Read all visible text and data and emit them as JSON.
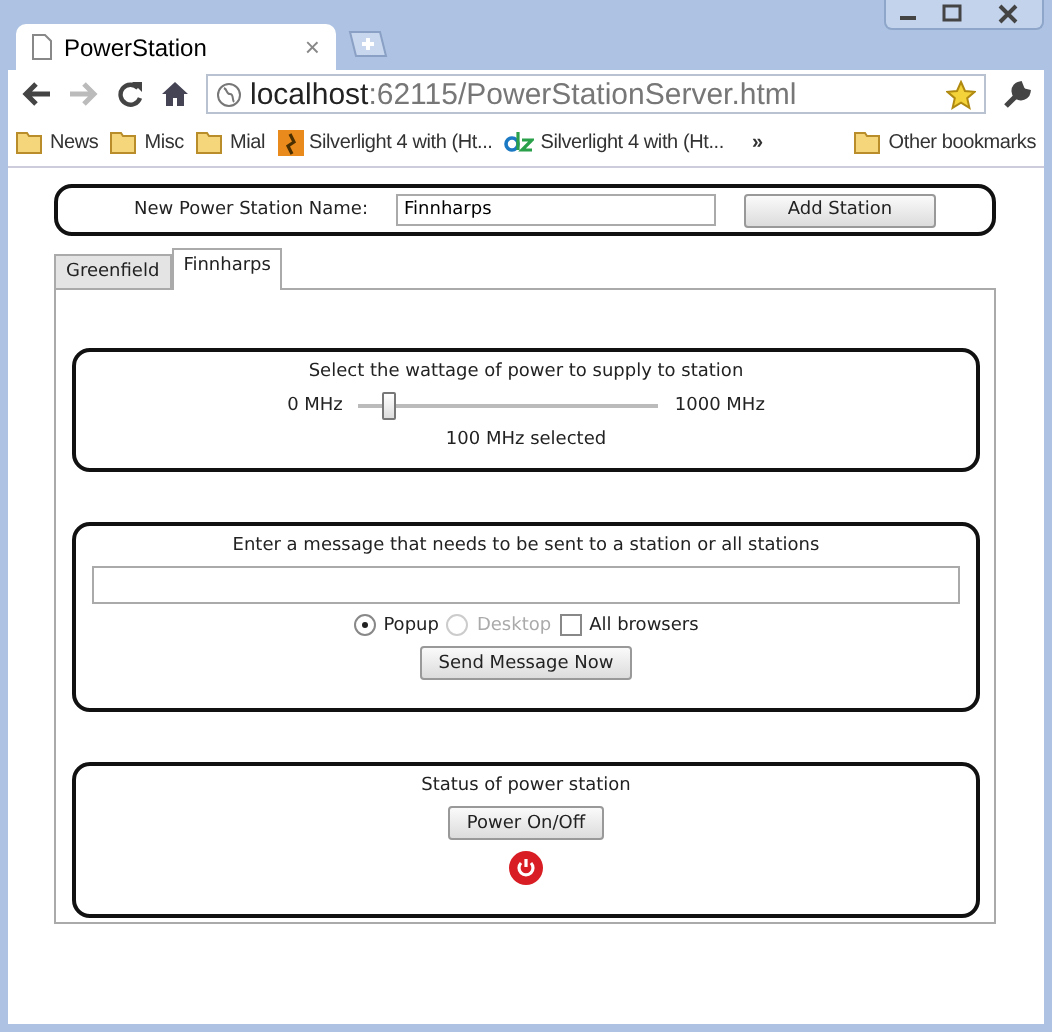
{
  "browser": {
    "tab_title": "PowerStation",
    "tab_close": "×",
    "address_host": "localhost",
    "address_path": ":62115/PowerStationServer.html",
    "bookmarks": [
      {
        "label": "News",
        "kind": "folder"
      },
      {
        "label": "Misc",
        "kind": "folder"
      },
      {
        "label": "Mial",
        "kind": "folder"
      },
      {
        "label": "Silverlight 4 with (Ht...",
        "kind": "orange"
      },
      {
        "label": "Silverlight 4 with (Ht...",
        "kind": "dz"
      }
    ],
    "more": "»",
    "other_bookmarks": "Other bookmarks"
  },
  "add_station": {
    "label": "New Power Station Name:",
    "value": "Finnharps",
    "button": "Add Station"
  },
  "tabs": [
    {
      "label": "Greenfield",
      "selected": false
    },
    {
      "label": "Finnharps",
      "selected": true
    }
  ],
  "wattage": {
    "title": "Select the wattage of power to supply to station",
    "min": "0 MHz",
    "max": "1000 MHz",
    "level": 0.1,
    "reading": "100 MHz selected"
  },
  "message": {
    "title": "Enter a message that needs to be sent to a station or all stations",
    "options": [
      {
        "kind": "radio",
        "label": "Popup",
        "checked": true,
        "disabled": false
      },
      {
        "kind": "radio",
        "label": "Desktop",
        "checked": false,
        "disabled": true
      },
      {
        "kind": "checkbox",
        "label": "All browsers",
        "checked": false,
        "disabled": false
      }
    ],
    "button": "Send Message Now"
  },
  "status": {
    "title": "Status of power station",
    "button": "Power On/Off"
  }
}
